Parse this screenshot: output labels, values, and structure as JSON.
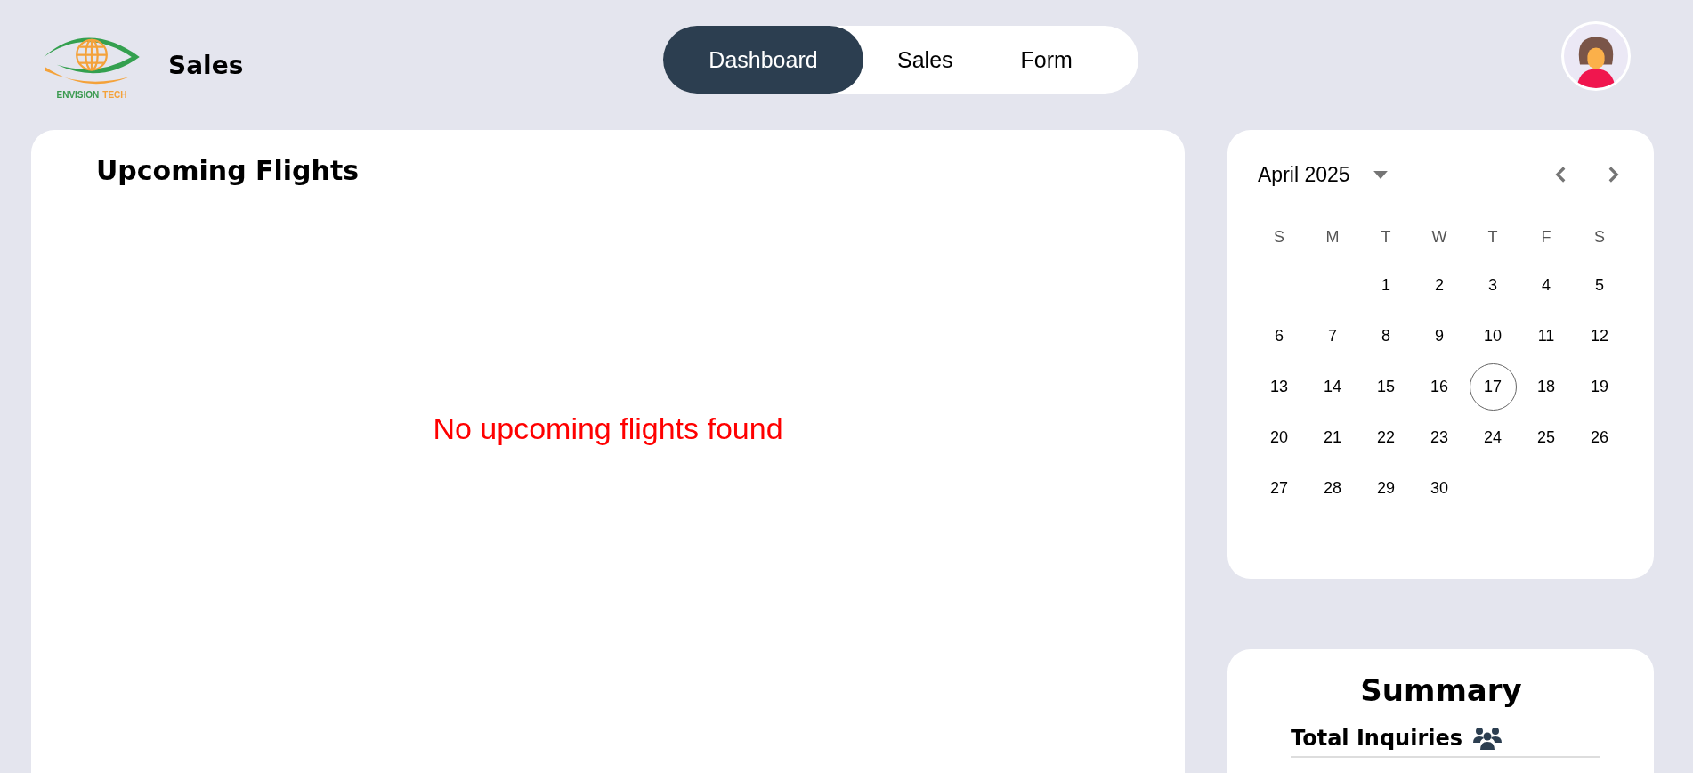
{
  "logo": {
    "words": [
      {
        "text": "ENVISION",
        "color": "#3a9a4f"
      },
      {
        "text": "TECH",
        "color": "#f4a23a"
      }
    ]
  },
  "app_title": "Sales",
  "nav_tabs": [
    {
      "label": "Dashboard",
      "selected": true
    },
    {
      "label": "Sales",
      "selected": false
    },
    {
      "label": "Form",
      "selected": false
    }
  ],
  "flights": {
    "title": "Upcoming Flights",
    "empty_message": "No upcoming flights found"
  },
  "calendar": {
    "month": "April 2025",
    "weekdays": [
      "S",
      "M",
      "T",
      "W",
      "T",
      "F",
      "S"
    ],
    "weeks": [
      [
        {
          "label": "1",
          "selected": false
        },
        {
          "label": "2",
          "selected": false
        },
        {
          "label": "3",
          "selected": false
        },
        {
          "label": "4",
          "selected": false
        },
        {
          "label": "5",
          "selected": false
        }
      ],
      [
        {
          "label": "6",
          "selected": false
        },
        {
          "label": "7",
          "selected": false
        },
        {
          "label": "8",
          "selected": false
        },
        {
          "label": "9",
          "selected": false
        },
        {
          "label": "10",
          "selected": false
        },
        {
          "label": "11",
          "selected": false
        },
        {
          "label": "12",
          "selected": false
        }
      ],
      [
        {
          "label": "13",
          "selected": false
        },
        {
          "label": "14",
          "selected": false
        },
        {
          "label": "15",
          "selected": false
        },
        {
          "label": "16",
          "selected": false
        },
        {
          "label": "17",
          "selected": true
        },
        {
          "label": "18",
          "selected": false
        },
        {
          "label": "19",
          "selected": false
        }
      ],
      [
        {
          "label": "20",
          "selected": false
        },
        {
          "label": "21",
          "selected": false
        },
        {
          "label": "22",
          "selected": false
        },
        {
          "label": "23",
          "selected": false
        },
        {
          "label": "24",
          "selected": false
        },
        {
          "label": "25",
          "selected": false
        },
        {
          "label": "26",
          "selected": false
        }
      ],
      [
        {
          "label": "27",
          "selected": false
        },
        {
          "label": "28",
          "selected": false
        },
        {
          "label": "29",
          "selected": false
        },
        {
          "label": "30",
          "selected": false
        }
      ]
    ]
  },
  "summary": {
    "title": "Summary",
    "items": [
      {
        "label": "Total Inquiries"
      }
    ]
  }
}
